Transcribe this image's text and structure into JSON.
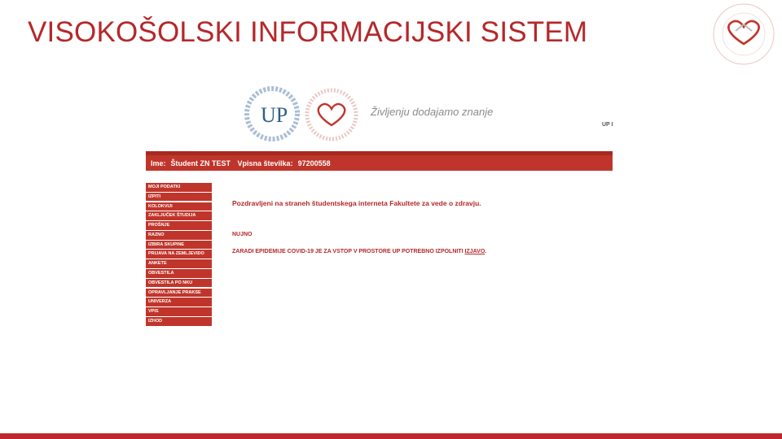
{
  "slide": {
    "title": "VISOKOŠOLSKI INFORMACIJSKI SISTEM"
  },
  "logos": {
    "up_letters": "UP"
  },
  "portal": {
    "tagline": "Življenju dodajamo znanje",
    "top_right_tag": "UP I",
    "student_bar": {
      "name_label": "Ime:",
      "name_value": "Študent ZN TEST",
      "id_label": "Vpisna številka:",
      "id_value": "97200558"
    },
    "menu": [
      "MOJI PODATKI",
      "IZPITI",
      "KOLOKVIJI",
      "ZAKLJUČEK ŠTUDIJA",
      "PROŠNJE",
      "RAZNO",
      "IZBIRA SKUPINE",
      "PRIJAVA NA ZEMLJEVIDO",
      "ANKETE",
      "OBVESTILA",
      "OBVESTILA PO NKU",
      "OPRAVLJANJE PRAKSE",
      "UNIVERZA",
      "VPIS",
      "IZHOD"
    ],
    "welcome": "Pozdravljeni na straneh študentskega interneta Fakultete za vede o zdravju.",
    "nujno": "NUJNO",
    "notice_text": "ZARADI EPIDEMIJE COVID-19 JE ZA VSTOP V PROSTORE UP POTREBNO IZPOLNITI ",
    "notice_link": "IZJAVO",
    "notice_end": "."
  },
  "colors": {
    "accent": "#c0352b",
    "title": "#b5282a"
  }
}
